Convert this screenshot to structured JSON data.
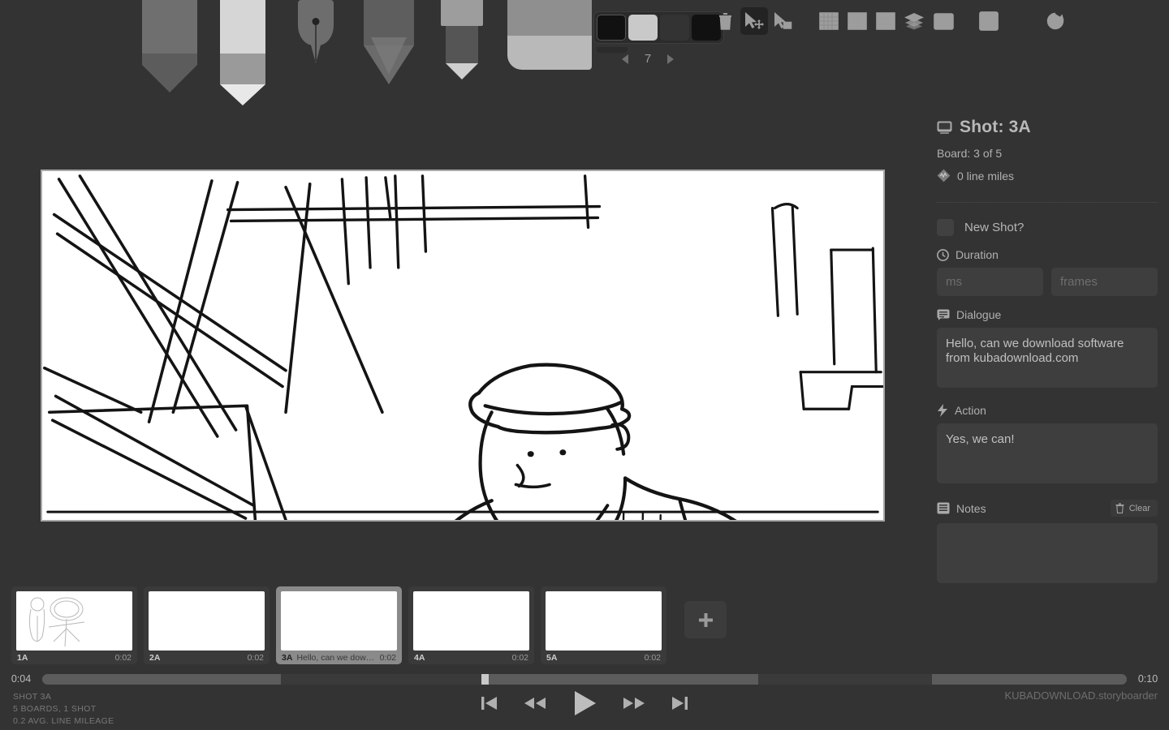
{
  "app": {
    "watermark": "KUBADOWNLOAD.storyboarder"
  },
  "toolbar": {
    "tools": [
      {
        "name": "marker-tool",
        "label": "Marker"
      },
      {
        "name": "light-pencil-tool",
        "label": "Light Pencil"
      },
      {
        "name": "pen-tool",
        "label": "Pen"
      },
      {
        "name": "pencil-tool",
        "label": "Pencil"
      },
      {
        "name": "brush-tool",
        "label": "Brush"
      },
      {
        "name": "eraser-tool",
        "label": "Eraser"
      }
    ],
    "palette": {
      "swatches": [
        "#111111",
        "#c9c9c9",
        "#333333",
        "#111111"
      ],
      "selected_index": 0,
      "brush_size": "7",
      "prev_label": "◀",
      "next_label": "▶"
    },
    "actions": [
      {
        "name": "trash-icon",
        "label": "Delete"
      },
      {
        "name": "move-tool-icon",
        "label": "Move",
        "active": true
      },
      {
        "name": "scale-tool-icon",
        "label": "Scale"
      }
    ],
    "view_actions": [
      {
        "name": "grid-icon",
        "label": "Grid"
      },
      {
        "name": "grid-quarters-icon",
        "label": "Grid Quarters"
      },
      {
        "name": "grid-thirds-icon",
        "label": "Grid Thirds"
      },
      {
        "name": "layers-icon",
        "label": "Layers"
      },
      {
        "name": "board-icon",
        "label": "Board"
      },
      {
        "name": "photoshop-icon",
        "label": "Ps"
      },
      {
        "name": "refresh-icon",
        "label": "Reload"
      }
    ]
  },
  "panel": {
    "shot_title": "Shot: 3A",
    "board_count": "Board: 3 of 5",
    "line_miles": "0 line miles",
    "new_shot_label": "New Shot?",
    "new_shot_checked": false,
    "duration_label": "Duration",
    "duration_ms_value": "",
    "duration_ms_placeholder": "ms",
    "duration_frames_value": "",
    "duration_frames_placeholder": "frames",
    "dialogue_label": "Dialogue",
    "dialogue_value": "Hello, can we download software from kubadownload.com",
    "action_label": "Action",
    "action_value": "Yes, we can!",
    "notes_label": "Notes",
    "notes_value": "",
    "clear_label": "Clear"
  },
  "thumbnails": [
    {
      "number": "1A",
      "dialogue": "",
      "duration": "0:02",
      "selected": false,
      "has_sketch": true
    },
    {
      "number": "2A",
      "dialogue": "",
      "duration": "0:02",
      "selected": false,
      "has_sketch": false
    },
    {
      "number": "3A",
      "dialogue": "Hello, can we downloa...",
      "duration": "0:02",
      "selected": true,
      "has_sketch": false
    },
    {
      "number": "4A",
      "dialogue": "",
      "duration": "0:02",
      "selected": false,
      "has_sketch": false
    },
    {
      "number": "5A",
      "dialogue": "",
      "duration": "0:02",
      "selected": false,
      "has_sketch": false
    }
  ],
  "add_board_label": "+",
  "timeline": {
    "start_time": "0:04",
    "end_time": "0:10",
    "playhead_percent": 40.5,
    "segments": [
      {
        "start_percent": 0,
        "width_percent": 22
      },
      {
        "start_percent": 40.5,
        "width_percent": 25.5
      },
      {
        "start_percent": 82,
        "width_percent": 18
      }
    ]
  },
  "status": {
    "line1": "SHOT 3A",
    "line2": "5 BOARDS, 1 SHOT",
    "line3": "0.2 AVG. LINE MILEAGE"
  },
  "transport": [
    {
      "name": "skip-to-start-button",
      "label": "Skip to start"
    },
    {
      "name": "rewind-button",
      "label": "Rewind"
    },
    {
      "name": "play-button",
      "label": "Play"
    },
    {
      "name": "fast-forward-button",
      "label": "Fast forward"
    },
    {
      "name": "skip-to-end-button",
      "label": "Skip to end"
    }
  ],
  "colors": {
    "background": "#333333",
    "panel_field": "#3e3e3e",
    "accent_selected": "#8a8a8a",
    "canvas": "#ffffff"
  }
}
